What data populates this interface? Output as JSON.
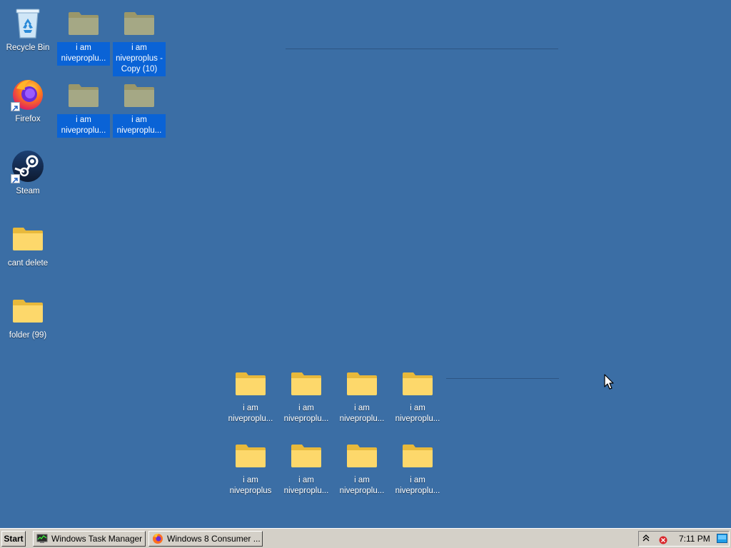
{
  "desktop": {
    "background": "#3b6ea5",
    "selection_color": "#0a63d6",
    "icons": [
      {
        "id": "recycle-bin",
        "label": "Recycle Bin",
        "icon": "recycle-bin-icon"
      },
      {
        "id": "firefox",
        "label": "Firefox",
        "icon": "firefox-icon",
        "shortcut": true
      },
      {
        "id": "steam",
        "label": "Steam",
        "icon": "steam-icon",
        "shortcut": true
      },
      {
        "id": "cant-delete",
        "label": "cant delete",
        "icon": "folder-icon"
      },
      {
        "id": "folder-99",
        "label": "folder (99)",
        "icon": "folder-icon"
      },
      {
        "id": "sel-1",
        "label": "i am niveproplu...",
        "icon": "folder-icon",
        "selected": true
      },
      {
        "id": "sel-2",
        "label": "i am niveproplus - Copy (10)",
        "icon": "folder-icon",
        "selected": true
      },
      {
        "id": "sel-3",
        "label": "i am niveproplu...",
        "icon": "folder-icon",
        "selected": true
      },
      {
        "id": "sel-4",
        "label": "i am niveproplu...",
        "icon": "folder-icon",
        "selected": true
      },
      {
        "id": "grid-1",
        "label": "i am niveproplu...",
        "icon": "folder-icon"
      },
      {
        "id": "grid-2",
        "label": "i am niveproplu...",
        "icon": "folder-icon"
      },
      {
        "id": "grid-3",
        "label": "i am niveproplu...",
        "icon": "folder-icon"
      },
      {
        "id": "grid-4",
        "label": "i am niveproplu...",
        "icon": "folder-icon"
      },
      {
        "id": "grid-5",
        "label": "i am niveproplus",
        "icon": "folder-icon"
      },
      {
        "id": "grid-6",
        "label": "i am niveproplu...",
        "icon": "folder-icon"
      },
      {
        "id": "grid-7",
        "label": "i am niveproplu...",
        "icon": "folder-icon"
      },
      {
        "id": "grid-8",
        "label": "i am niveproplu...",
        "icon": "folder-icon"
      }
    ]
  },
  "taskbar": {
    "start_label": "Start",
    "tasks": [
      {
        "label": "Windows Task Manager",
        "icon": "task-manager-icon"
      },
      {
        "label": "Windows 8 Consumer ...",
        "icon": "firefox-icon"
      }
    ],
    "tray": {
      "clock": "7:11 PM",
      "icons": [
        "show-hidden-icons-chevron",
        "network-error-icon",
        "desktop-preview-icon"
      ]
    }
  }
}
